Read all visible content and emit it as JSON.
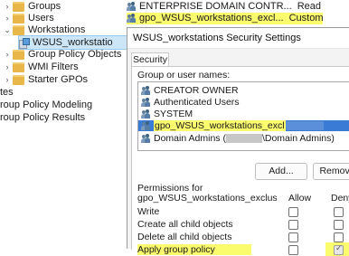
{
  "tree": {
    "items": [
      {
        "label": "Groups",
        "type": "folder"
      },
      {
        "label": "Users",
        "type": "folder"
      },
      {
        "label": "Workstations",
        "type": "folder"
      },
      {
        "label": "WSUS_workstatio",
        "type": "gpo"
      },
      {
        "label": "Group Policy Objects",
        "type": "folder"
      },
      {
        "label": "WMI Filters",
        "type": "folder"
      },
      {
        "label": "Starter GPOs",
        "type": "folder"
      },
      {
        "label": "tes",
        "type": "none"
      },
      {
        "label": "roup Policy Modeling",
        "type": "none"
      },
      {
        "label": "roup Policy Results",
        "type": "none"
      }
    ]
  },
  "top_list": {
    "rows": [
      {
        "name": "ENTERPRISE DOMAIN CONTR...",
        "value": "Read"
      },
      {
        "name": "gpo_WSUS_workstations_excl...",
        "value": "Custom"
      }
    ]
  },
  "dialog": {
    "title": "WSUS_workstations Security Settings",
    "tab": "Security",
    "group_label": "Group or user names:",
    "users": [
      {
        "name": "CREATOR OWNER"
      },
      {
        "name": "Authenticated Users"
      },
      {
        "name": "SYSTEM"
      },
      {
        "name": "gpo_WSUS_workstations_excl"
      },
      {
        "name_prefix": "Domain Admins (",
        "name_suffix": "\\Domain Admins)"
      }
    ],
    "add_button": "Add...",
    "remove_button": "Remove",
    "permissions_label_1": "Permissions for",
    "permissions_label_2": "gpo_WSUS_workstations_exclus",
    "col_allow": "Allow",
    "col_deny": "Deny",
    "permissions": [
      {
        "name": "Write",
        "allow": false,
        "deny": false
      },
      {
        "name": "Create all child objects",
        "allow": false,
        "deny": false
      },
      {
        "name": "Delete all child objects",
        "allow": false,
        "deny": false
      },
      {
        "name": "Apply group policy",
        "allow": false,
        "deny": true
      }
    ]
  },
  "colors": {
    "highlight": "#fbfb6e",
    "selection": "#3a7bd5"
  }
}
